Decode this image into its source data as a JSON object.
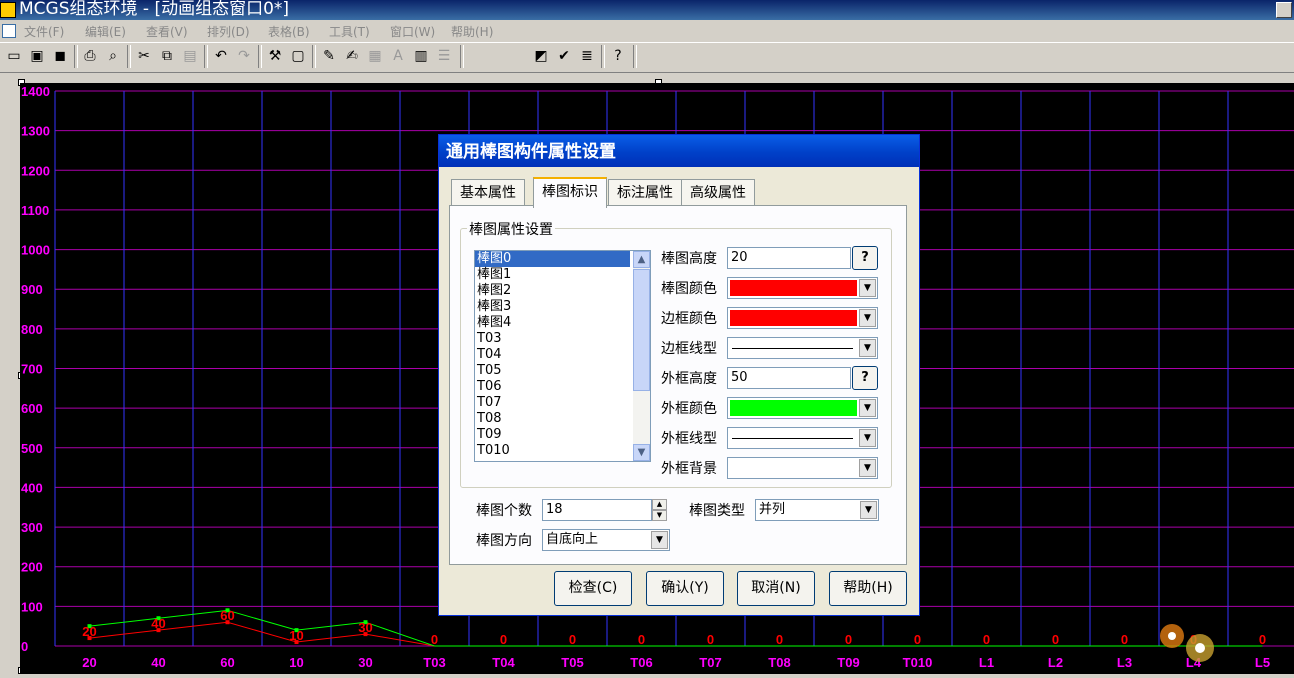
{
  "window": {
    "title": "MCGS组态环境 - [动画组态窗口0*]"
  },
  "menu": [
    "文件(F)",
    "编辑(E)",
    "查看(V)",
    "排列(D)",
    "表格(B)",
    "工具(T)",
    "窗口(W)",
    "帮助(H)"
  ],
  "chart_data": {
    "type": "line",
    "yticks": [
      "1400",
      "1300",
      "1200",
      "1100",
      "1000",
      "900",
      "800",
      "700",
      "600",
      "500",
      "400",
      "300",
      "200",
      "100",
      "0"
    ],
    "ylim": [
      0,
      1400
    ],
    "categories": [
      "20",
      "40",
      "60",
      "10",
      "30",
      "T03",
      "T04",
      "T05",
      "T06",
      "T07",
      "T08",
      "T09",
      "T010",
      "L1",
      "L2",
      "L3",
      "L4",
      "L5"
    ],
    "value_labels": [
      "20",
      "40",
      "60",
      "10",
      "30",
      "0",
      "0",
      "0",
      "0",
      "0",
      "0",
      "0",
      "0",
      "0",
      "0",
      "0",
      "0",
      "0"
    ],
    "series": [
      {
        "color": "#ff0000",
        "values": [
          20,
          40,
          60,
          10,
          30,
          0,
          0,
          0,
          0,
          0,
          0,
          0,
          0,
          0,
          0,
          0,
          0,
          0
        ]
      },
      {
        "color": "#00ff00",
        "values": [
          50,
          70,
          90,
          40,
          60,
          0,
          0,
          0,
          0,
          0,
          0,
          0,
          0,
          0,
          0,
          0,
          0,
          0
        ]
      }
    ],
    "grid": true,
    "colors": {
      "background": "#000000",
      "grid_vertical": "#3333ff",
      "grid_horizontal": "#aa00aa",
      "axis_label": "#ff00ff",
      "value_label": "#ff0000"
    }
  },
  "dialog": {
    "title": "通用棒图构件属性设置",
    "tabs": [
      "基本属性",
      "棒图标识",
      "标注属性",
      "高级属性"
    ],
    "group_title": "棒图属性设置",
    "list_items": [
      "棒图0",
      "棒图1",
      "棒图2",
      "棒图3",
      "棒图4",
      "T03",
      "T04",
      "T05",
      "T06",
      "T07",
      "T08",
      "T09",
      "T010"
    ],
    "fields": {
      "bar_height_label": "棒图高度",
      "bar_height_value": "20",
      "question": "?",
      "bar_color_label": "棒图颜色",
      "bar_color": "#ff0000",
      "border_color_label": "边框颜色",
      "border_color": "#ff0000",
      "border_style_label": "边框线型",
      "frame_height_label": "外框高度",
      "frame_height_value": "50",
      "frame_color_label": "外框颜色",
      "frame_color": "#00ff00",
      "frame_style_label": "外框线型",
      "frame_bg_label": "外框背景",
      "bar_count_label": "棒图个数",
      "bar_count_value": "18",
      "bar_type_label": "棒图类型",
      "bar_type_value": "并列",
      "bar_dir_label": "棒图方向",
      "bar_dir_value": "自底向上"
    },
    "buttons": {
      "check": "检查(C)",
      "ok": "确认(Y)",
      "cancel": "取消(N)",
      "help": "帮助(H)"
    }
  }
}
